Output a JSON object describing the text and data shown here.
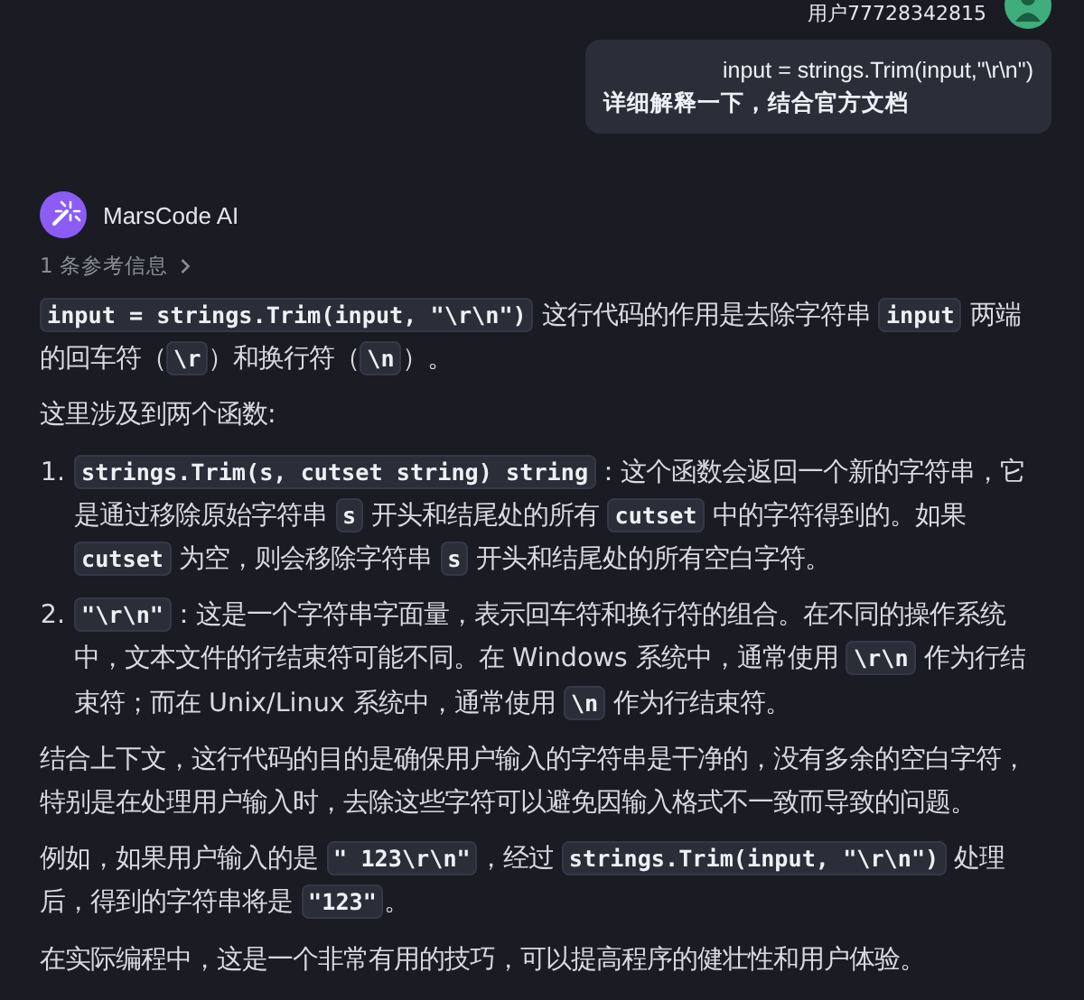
{
  "user": {
    "name": "用户77728342815",
    "message_lines": [
      "input = strings.Trim(input,\"\\r\\n\")",
      "详细解释一下，结合官方文档"
    ]
  },
  "assistant": {
    "name": "MarsCode AI",
    "references": "1 条参考信息",
    "blocks": [
      {
        "kind": "paragraph",
        "segments": [
          {
            "kind": "code",
            "text": "input = strings.Trim(input, \"\\r\\n\")"
          },
          {
            "kind": "text",
            "text": " 这行代码的作用是去除字符串 "
          },
          {
            "kind": "code",
            "text": "input"
          },
          {
            "kind": "text",
            "text": " 两端的回车符（"
          },
          {
            "kind": "code",
            "text": "\\r"
          },
          {
            "kind": "text",
            "text": "）和换行符（"
          },
          {
            "kind": "code",
            "text": "\\n"
          },
          {
            "kind": "text",
            "text": "）。"
          }
        ]
      },
      {
        "kind": "paragraph",
        "segments": [
          {
            "kind": "text",
            "text": "这里涉及到两个函数:"
          }
        ]
      },
      {
        "kind": "list",
        "items": [
          {
            "number": "1.",
            "segments": [
              {
                "kind": "code",
                "text": "strings.Trim(s, cutset string) string"
              },
              {
                "kind": "text",
                "text": "：这个函数会返回一个新的字符串，它是通过移除原始字符串 "
              },
              {
                "kind": "code",
                "text": "s"
              },
              {
                "kind": "text",
                "text": " 开头和结尾处的所有 "
              },
              {
                "kind": "code",
                "text": "cutset"
              },
              {
                "kind": "text",
                "text": " 中的字符得到的。如果 "
              },
              {
                "kind": "code",
                "text": "cutset"
              },
              {
                "kind": "text",
                "text": " 为空，则会移除字符串 "
              },
              {
                "kind": "code",
                "text": "s"
              },
              {
                "kind": "text",
                "text": " 开头和结尾处的所有空白字符。"
              }
            ]
          },
          {
            "number": "2.",
            "segments": [
              {
                "kind": "code",
                "text": "\"\\r\\n\""
              },
              {
                "kind": "text",
                "text": "：这是一个字符串字面量，表示回车符和换行符的组合。在不同的操作系统中，文本文件的行结束符可能不同。在 Windows 系统中，通常使用 "
              },
              {
                "kind": "code",
                "text": "\\r\\n"
              },
              {
                "kind": "text",
                "text": " 作为行结束符；而在 Unix/Linux 系统中，通常使用 "
              },
              {
                "kind": "code",
                "text": "\\n"
              },
              {
                "kind": "text",
                "text": " 作为行结束符。"
              }
            ]
          }
        ]
      },
      {
        "kind": "paragraph",
        "segments": [
          {
            "kind": "text",
            "text": "结合上下文，这行代码的目的是确保用户输入的字符串是干净的，没有多余的空白字符，特别是在处理用户输入时，去除这些字符可以避免因输入格式不一致而导致的问题。"
          }
        ]
      },
      {
        "kind": "paragraph",
        "segments": [
          {
            "kind": "text",
            "text": "例如，如果用户输入的是 "
          },
          {
            "kind": "code",
            "text": "\" 123\\r\\n\""
          },
          {
            "kind": "text",
            "text": "，经过 "
          },
          {
            "kind": "code",
            "text": "strings.Trim(input, \"\\r\\n\")"
          },
          {
            "kind": "text",
            "text": " 处理后，得到的字符串将是 "
          },
          {
            "kind": "code",
            "text": "\"123\""
          },
          {
            "kind": "text",
            "text": "。"
          }
        ]
      },
      {
        "kind": "paragraph",
        "segments": [
          {
            "kind": "text",
            "text": "在实际编程中，这是一个非常有用的技巧，可以提高程序的健壮性和用户体验。"
          }
        ]
      }
    ]
  }
}
